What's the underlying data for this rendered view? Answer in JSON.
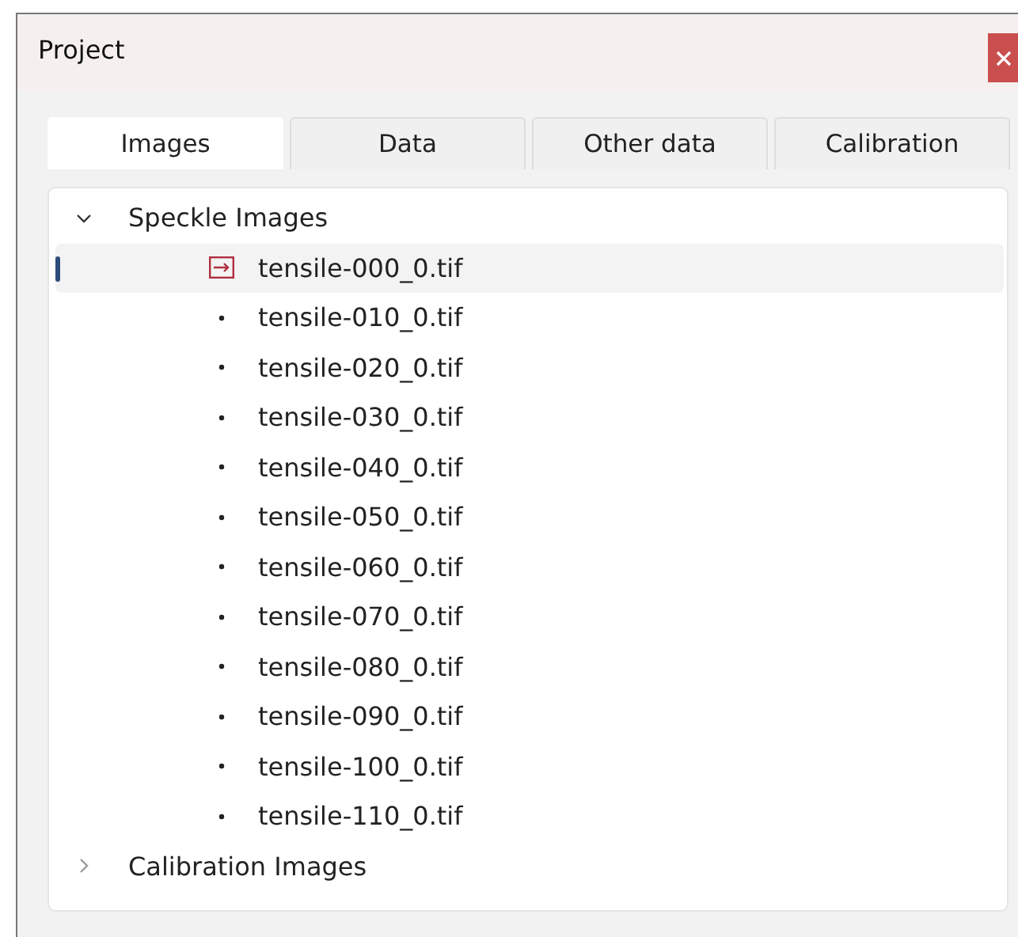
{
  "window": {
    "title": "Project"
  },
  "tabs": [
    {
      "label": "Images",
      "selected": true
    },
    {
      "label": "Data",
      "selected": false
    },
    {
      "label": "Other data",
      "selected": false
    },
    {
      "label": "Calibration",
      "selected": false
    }
  ],
  "tree": [
    {
      "label": "Speckle Images",
      "expanded": true,
      "children": [
        {
          "label": "tensile-000_0.tif",
          "kind": "current",
          "selected": true
        },
        {
          "label": "tensile-010_0.tif",
          "kind": "bullet",
          "selected": false
        },
        {
          "label": "tensile-020_0.tif",
          "kind": "bullet",
          "selected": false
        },
        {
          "label": "tensile-030_0.tif",
          "kind": "bullet",
          "selected": false
        },
        {
          "label": "tensile-040_0.tif",
          "kind": "bullet",
          "selected": false
        },
        {
          "label": "tensile-050_0.tif",
          "kind": "bullet",
          "selected": false
        },
        {
          "label": "tensile-060_0.tif",
          "kind": "bullet",
          "selected": false
        },
        {
          "label": "tensile-070_0.tif",
          "kind": "bullet",
          "selected": false
        },
        {
          "label": "tensile-080_0.tif",
          "kind": "bullet",
          "selected": false
        },
        {
          "label": "tensile-090_0.tif",
          "kind": "bullet",
          "selected": false
        },
        {
          "label": "tensile-100_0.tif",
          "kind": "bullet",
          "selected": false
        },
        {
          "label": "tensile-110_0.tif",
          "kind": "bullet",
          "selected": false
        }
      ]
    },
    {
      "label": "Calibration Images",
      "expanded": false
    }
  ]
}
